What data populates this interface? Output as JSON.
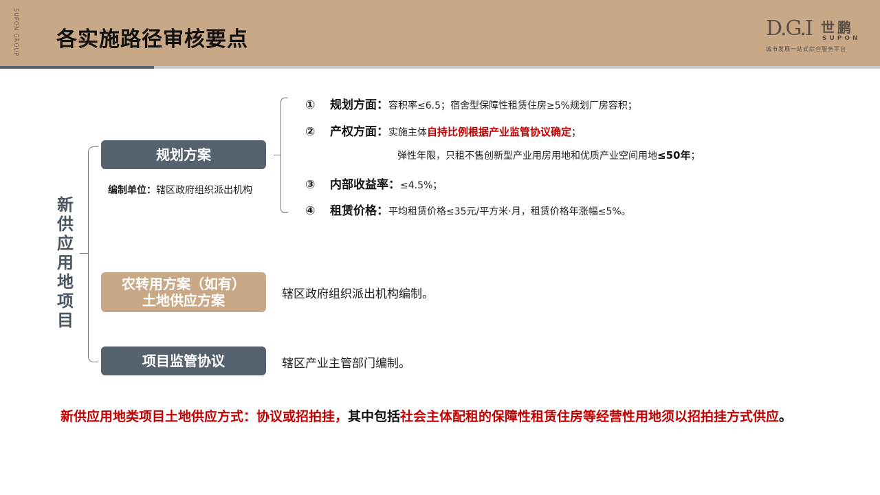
{
  "brand": {
    "side_label": "SUPON GROUP",
    "logo_mark": "D.G.I",
    "logo_cn": "世鹏",
    "logo_en": "SUPON",
    "logo_tagline": "城市发展一站式综合服务平台"
  },
  "header": {
    "title": "各实施路径审核要点"
  },
  "left": {
    "vertical_title": "新供应用地项目"
  },
  "plan_box": {
    "label": "规划方案"
  },
  "prep_unit": {
    "label": "编制单位：",
    "value": "辖区政府组织派出机构"
  },
  "items": [
    {
      "num": "①",
      "label": "规划方面：",
      "text": "容积率≤6.5；宿舍型保障性租赁住房≥5%规划厂房容积；"
    },
    {
      "num": "②",
      "label": "产权方面：",
      "pre": "实施主体",
      "highlight": "自持比例根据产业监管协议确定",
      "post": "；"
    },
    {
      "cont_pre": "弹性年限，只租不售创新型产业用房用地和优质产业空间用地",
      "cont_bold": "≤50年",
      "cont_post": "；"
    },
    {
      "num": "③",
      "label": "内部收益率：",
      "text": "≤4.5%；"
    },
    {
      "num": "④",
      "label": "租赁价格：",
      "text": "平均租赁价格≤35元/平方米·月，租赁价格年涨幅≤5%。"
    }
  ],
  "land_box": {
    "line1": "农转用方案（如有）",
    "line2": "土地供应方案",
    "desc": "辖区政府组织派出机构编制。"
  },
  "supervise_box": {
    "label": "项目监管协议",
    "desc": "辖区产业主管部门编制。"
  },
  "footer": {
    "part1": "新供应用地类项目土地供应方式：协议或招拍挂，",
    "part2": "其中包括",
    "part3": "社会主体配租的保障性租赁住房等经营性用地须以招拍挂方式供应",
    "part4": "。"
  },
  "colors": {
    "header_bg": "#c9a887",
    "dark_box": "#56626e",
    "accent_red": "#c00000"
  }
}
